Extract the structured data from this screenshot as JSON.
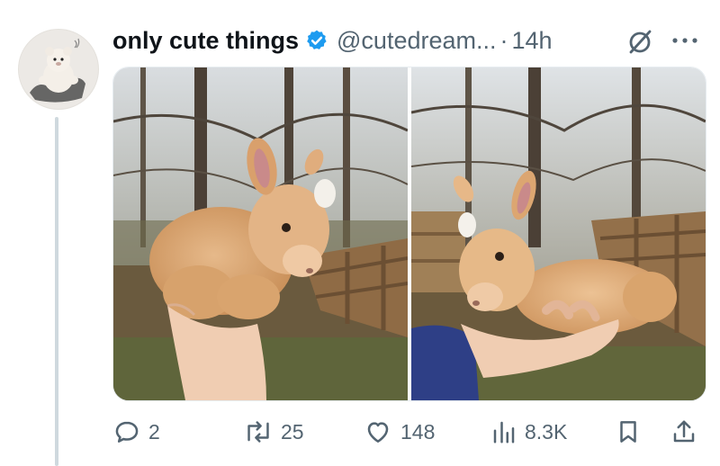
{
  "tweet": {
    "display_name": "only cute things",
    "handle": "@cutedream...",
    "separator": "·",
    "time": "14h",
    "verified": true,
    "brand_color": "#1d9bf0"
  },
  "media": {
    "images": [
      {
        "icon": "baby-goat-photo-left"
      },
      {
        "icon": "baby-goat-photo-right"
      }
    ]
  },
  "actions": {
    "replies": "2",
    "reposts": "25",
    "likes": "148",
    "views": "8.3K"
  },
  "icons": {
    "reply": "speech-bubble-icon",
    "repost": "repost-arrows-icon",
    "like": "heart-icon",
    "views": "bar-chart-icon",
    "bookmark": "bookmark-icon",
    "share": "share-upload-icon",
    "grok": "grok-slash-circle-icon",
    "more": "ellipsis-icon"
  },
  "colors": {
    "text_primary": "#0f1419",
    "text_secondary": "#536471",
    "thread_line": "#cfd9de"
  }
}
